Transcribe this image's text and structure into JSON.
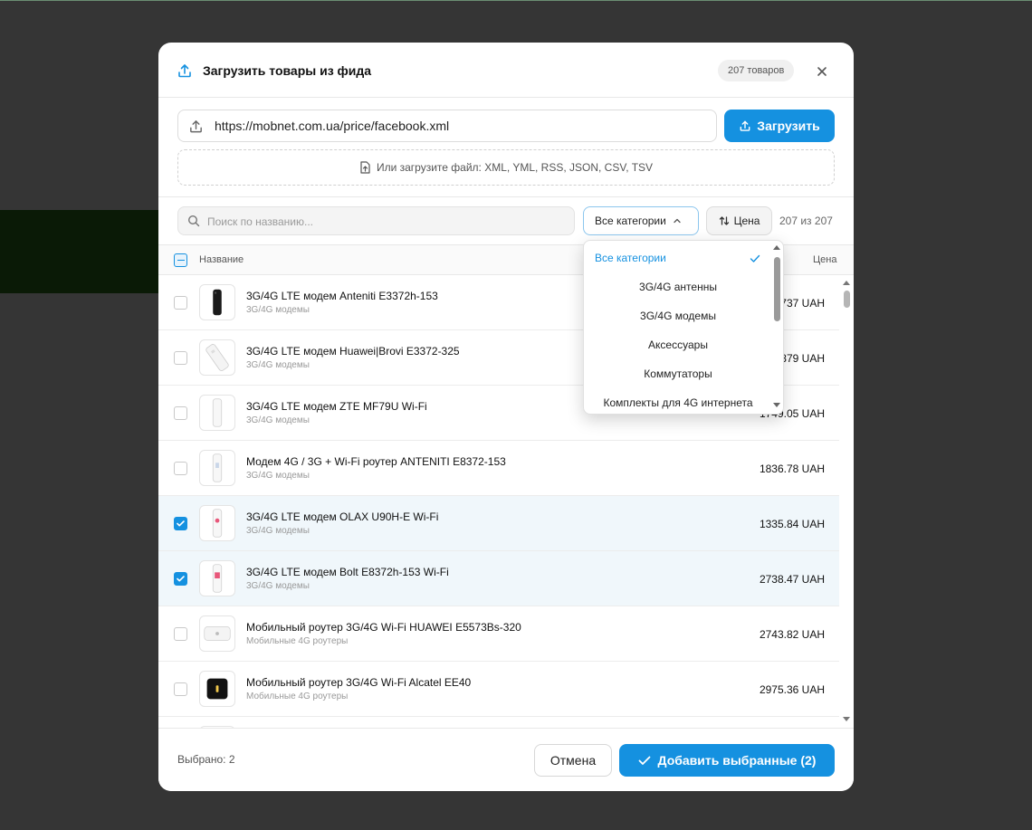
{
  "modal": {
    "title": "Загрузить товары из фида",
    "total_badge": "207 товаров"
  },
  "url": {
    "value": "https://mobnet.com.ua/price/facebook.xml",
    "load_label": "Загрузить",
    "file_hint": "Или загрузите файл: XML, YML, RSS, JSON, CSV, TSV"
  },
  "filters": {
    "search_placeholder": "Поиск по названию...",
    "category_label": "Все категории",
    "price_sort_label": "Цена",
    "count_label": "207 из 207"
  },
  "table": {
    "col_name": "Название",
    "col_price": "Цена",
    "rows": [
      {
        "name": "3G/4G LTE модем Anteniti E3372h-153",
        "category": "3G/4G модемы",
        "price": "1737 UAH",
        "selected": false
      },
      {
        "name": "3G/4G LTE модем Huawei|Brovi E3372-325",
        "category": "3G/4G модемы",
        "price": "1879 UAH",
        "selected": false
      },
      {
        "name": "3G/4G LTE модем ZTE MF79U Wi-Fi",
        "category": "3G/4G модемы",
        "price": "1749.05 UAH",
        "selected": false
      },
      {
        "name": "Модем 4G / 3G + Wi-Fi роутер ANTENITI E8372-153",
        "category": "3G/4G модемы",
        "price": "1836.78 UAH",
        "selected": false
      },
      {
        "name": "3G/4G LTE модем OLAX U90H-E Wi-Fi",
        "category": "3G/4G модемы",
        "price": "1335.84 UAH",
        "selected": true
      },
      {
        "name": "3G/4G LTE модем Bolt E8372h-153 Wi-Fi",
        "category": "3G/4G модемы",
        "price": "2738.47 UAH",
        "selected": true
      },
      {
        "name": "Мобильный роутер 3G/4G Wi-Fi HUAWEI E5573Bs-320",
        "category": "Мобильные 4G роутеры",
        "price": "2743.82 UAH",
        "selected": false
      },
      {
        "name": "Мобильный роутер 3G/4G Wi-Fi Alcatel EE40",
        "category": "Мобильные 4G роутеры",
        "price": "2975.36 UAH",
        "selected": false
      }
    ]
  },
  "dropdown": {
    "options": [
      {
        "label": "Все категории",
        "active": true
      },
      {
        "label": "3G/4G антенны",
        "active": false
      },
      {
        "label": "3G/4G модемы",
        "active": false
      },
      {
        "label": "Аксессуары",
        "active": false
      },
      {
        "label": "Коммутаторы",
        "active": false
      },
      {
        "label": "Комплекты для 4G интернета",
        "active": false
      }
    ]
  },
  "footer": {
    "selected_label": "Выбрано: 2",
    "cancel_label": "Отмена",
    "add_label": "Добавить выбранные (2)"
  },
  "colors": {
    "accent": "#1591e0",
    "selected_row_bg": "#f0f7fb",
    "overlay": "#353535"
  }
}
